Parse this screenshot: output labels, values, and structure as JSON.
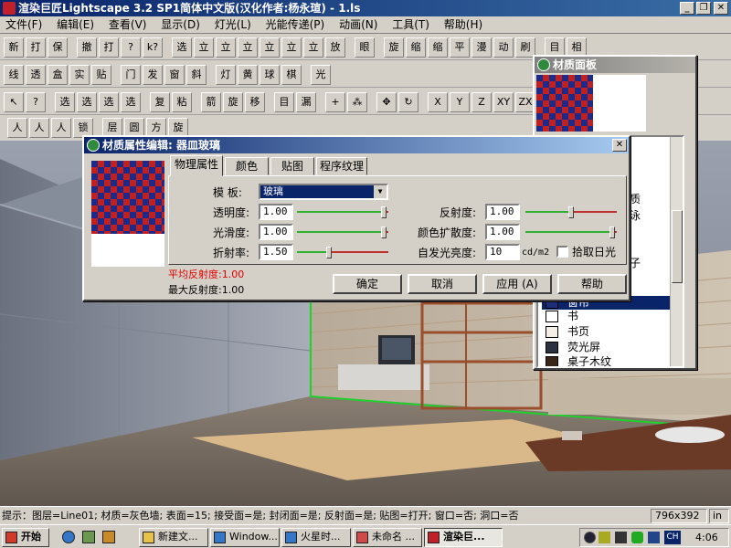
{
  "window": {
    "title": "渲染巨匠Lightscape 3.2 SP1简体中文版(汉化作者:杨永瑄) - 1.ls",
    "min": "_",
    "max": "❐",
    "close": "✕"
  },
  "menu": [
    "文件(F)",
    "编辑(E)",
    "查看(V)",
    "显示(D)",
    "灯光(L)",
    "光能传递(P)",
    "动画(N)",
    "工具(T)",
    "帮助(H)"
  ],
  "toolbar_icons": {
    "row1": [
      "新建",
      "打开",
      "保存",
      "撤销",
      "打印",
      "?",
      "k?",
      "选择",
      "立方体",
      "立方体",
      "立方体",
      "立方体",
      "立方体",
      "立方体",
      "放大镜",
      "眼睛",
      "旋转",
      "缩放+",
      "缩放-",
      "平移",
      "漫游",
      "动画",
      "刷新",
      "目标",
      "相机"
    ],
    "row2": [
      "线框",
      "透视",
      "盒",
      "实体",
      "贴图",
      "门",
      "发光",
      "窗",
      "斜线",
      "灯",
      "黄",
      "球",
      "棋盘",
      "光"
    ],
    "row3": [
      "↖",
      "?",
      "选",
      "选",
      "选",
      "选",
      "复制",
      "粘贴",
      "箭",
      "旋",
      "移",
      "目",
      "漏",
      "+",
      "⁂",
      "✥",
      "↻",
      "X",
      "Y",
      "Z",
      "XY",
      "ZX",
      "YZ"
    ],
    "row4": [
      "人",
      "人",
      "人",
      "锁",
      "层",
      "圆",
      "方",
      "旋"
    ],
    "axis": [
      "X",
      "Y",
      "Z",
      "XY",
      "ZX",
      "YZ"
    ]
  },
  "material_panel": {
    "title": "材质面板",
    "letters": [
      "质",
      "泳",
      "子"
    ],
    "items": [
      {
        "name": "窗帘",
        "swatch": "#1c2e7a",
        "selected": true
      },
      {
        "name": "书",
        "swatch": "#ffffff",
        "selected": false
      },
      {
        "name": "书页",
        "swatch": "#f3efe6",
        "selected": false
      },
      {
        "name": "荧光屏",
        "swatch": "#2b3140",
        "selected": false
      },
      {
        "name": "桌子木纹",
        "swatch": "#3a2618",
        "selected": false
      }
    ]
  },
  "material_editor": {
    "title": "材质属性编辑: 器皿玻璃",
    "tabs": [
      "物理属性",
      "颜色",
      "贴图",
      "程序纹理"
    ],
    "template_label": "模   板:",
    "template_value": "玻璃",
    "left_props": [
      {
        "label": "透明度:",
        "value": "1.00",
        "fraction": 0.95
      },
      {
        "label": "光滑度:",
        "value": "1.00",
        "fraction": 0.95
      },
      {
        "label": "折射率:",
        "value": "1.50",
        "fraction": 0.35
      }
    ],
    "right_props": [
      {
        "label": "反射度:",
        "value": "1.00",
        "fraction": 0.5
      },
      {
        "label": "颜色扩散度:",
        "value": "1.00",
        "fraction": 0.95
      }
    ],
    "emission_label": "自发光亮度:",
    "emission_value": "10",
    "emission_unit": "cd/m2",
    "daylight_label": "拾取日光",
    "avg_reflect": "平均反射度:1.00",
    "max_reflect": "最大反射度:1.00",
    "buttons": [
      "确定",
      "取消",
      "应用 (A)",
      "帮助"
    ],
    "close": "✕"
  },
  "status": {
    "text": "提示：图层=Line01; 材质=灰色墙; 表面=15; 接受面=是; 封闭面=是; 反射面=是; 贴图=打开; 窗口=否; 洞口=否",
    "size": "796x392",
    "mode": "in"
  },
  "taskbar": {
    "start": "开始",
    "tasks": [
      "新建文...",
      "Window...",
      "火星时...",
      "未命名 ...",
      "渲染巨..."
    ],
    "clock": "4:06",
    "lang": "CH"
  },
  "colors": {
    "title_blue": "#0a246a",
    "selection_blue": "#0a246a"
  }
}
